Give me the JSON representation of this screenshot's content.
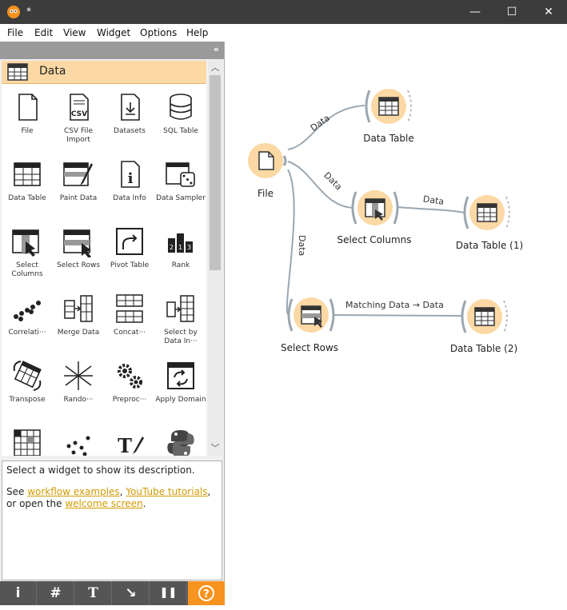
{
  "window": {
    "title": "*",
    "minimize": "—",
    "maximize": "☐",
    "close": "✕"
  },
  "menu": [
    "File",
    "Edit",
    "View",
    "Widget",
    "Options",
    "Help"
  ],
  "dock": {
    "collapse_label": "«"
  },
  "category": {
    "label": "Data",
    "icon": "table-icon",
    "color": "#fbd8a4"
  },
  "tools": [
    {
      "label": "File",
      "icon": "file-icon"
    },
    {
      "label": "CSV File Import",
      "icon": "csv-icon"
    },
    {
      "label": "Datasets",
      "icon": "datasets-icon"
    },
    {
      "label": "SQL Table",
      "icon": "database-icon"
    },
    {
      "label": "Data Table",
      "icon": "table-icon"
    },
    {
      "label": "Paint Data",
      "icon": "paint-icon"
    },
    {
      "label": "Data Info",
      "icon": "info-icon"
    },
    {
      "label": "Data Sampler",
      "icon": "sampler-icon"
    },
    {
      "label": "Select Columns",
      "icon": "select-columns-icon"
    },
    {
      "label": "Select Rows",
      "icon": "select-rows-icon"
    },
    {
      "label": "Pivot Table",
      "icon": "pivot-icon"
    },
    {
      "label": "Rank",
      "icon": "rank-icon"
    },
    {
      "label": "Correlati···",
      "icon": "correlations-icon"
    },
    {
      "label": "Merge Data",
      "icon": "merge-icon"
    },
    {
      "label": "Concat···",
      "icon": "concatenate-icon"
    },
    {
      "label": "Select by Data In···",
      "icon": "select-by-index-icon"
    },
    {
      "label": "Transpose",
      "icon": "transpose-icon"
    },
    {
      "label": "Rando···",
      "icon": "randomize-icon"
    },
    {
      "label": "Preproc···",
      "icon": "preprocess-icon"
    },
    {
      "label": "Apply Domain",
      "icon": "apply-domain-icon"
    },
    {
      "label": "",
      "icon": "grid-icon"
    },
    {
      "label": "",
      "icon": "scatter-icon"
    },
    {
      "label": "",
      "icon": "text-icon"
    },
    {
      "label": "",
      "icon": "python-icon"
    }
  ],
  "description": {
    "line1": "Select a widget to show its description.",
    "see": "See ",
    "link1": "workflow examples",
    "comma": ", ",
    "link2": "YouTube tutorials",
    "or_open": ", or open the ",
    "link3": "welcome screen",
    "period": "."
  },
  "bottom_buttons": [
    {
      "label": "i",
      "icon": "info-icon"
    },
    {
      "label": "#",
      "icon": "grid-icon"
    },
    {
      "label": "T",
      "icon": "text-annotation-icon"
    },
    {
      "label": "↘",
      "icon": "arrow-annotation-icon"
    },
    {
      "label": "❚❚",
      "icon": "pause-icon"
    },
    {
      "label": "?",
      "icon": "help-icon"
    }
  ],
  "workflow": {
    "nodes": {
      "file": "File",
      "data_table": "Data Table",
      "select_columns": "Select Columns",
      "data_table_1": "Data Table (1)",
      "select_rows": "Select Rows",
      "data_table_2": "Data Table (2)"
    },
    "links": {
      "file_to_table": "Data",
      "file_to_columns": "Data",
      "file_to_rows": "Data",
      "columns_to_table1": "Data",
      "rows_to_table2": "Matching Data → Data"
    }
  }
}
